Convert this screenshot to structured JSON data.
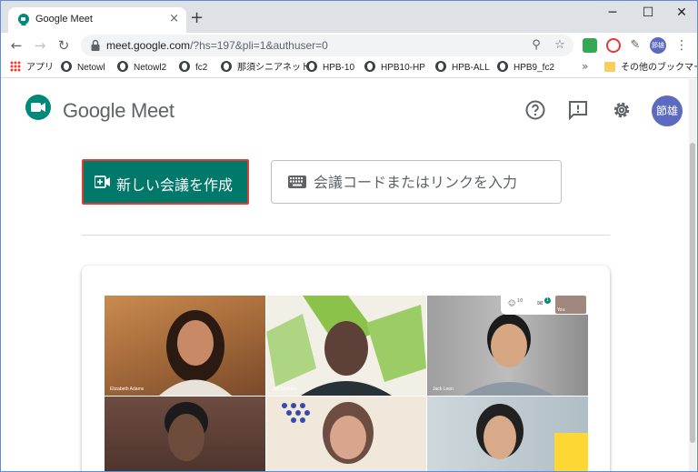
{
  "tab": {
    "title": "Google Meet",
    "close": "×",
    "new_tab": "+"
  },
  "window": {
    "minimize": "─",
    "maximize": "☐",
    "close": "✕"
  },
  "toolbar": {
    "url_host": "meet.google.com",
    "url_path": "/?hs=197&pli=1&authuser=0",
    "profile_label": "節雄"
  },
  "bookmarks": [
    {
      "label": "アプリ",
      "icon": "apps-icon"
    },
    {
      "label": "Netowl",
      "icon": "globe-icon"
    },
    {
      "label": "Netowl2",
      "icon": "globe-icon"
    },
    {
      "label": "fc2",
      "icon": "globe-icon"
    },
    {
      "label": "那須シニアネット",
      "icon": "globe-icon"
    },
    {
      "label": "HPB-10",
      "icon": "globe-icon"
    },
    {
      "label": "HPB10-HP",
      "icon": "globe-icon"
    },
    {
      "label": "HPB-ALL",
      "icon": "globe-icon"
    },
    {
      "label": "HPB9_fc2",
      "icon": "globe-icon"
    }
  ],
  "bookmarks_more": "»",
  "other_bookmarks": "その他のブックマーク",
  "meet": {
    "brand_google": "Google",
    "brand_meet": "Meet",
    "user_initials": "節雄",
    "new_meeting_label": "新しい会議を作成",
    "join_placeholder": "会議コードまたはリンクを入力",
    "participants": [
      {
        "name": "Elizabeth Adams"
      },
      {
        "name": "Jeff Sheldon"
      },
      {
        "name": "Jack Leon"
      },
      {
        "name": ""
      },
      {
        "name": ""
      },
      {
        "name": ""
      }
    ],
    "mini_count": "10",
    "mini_chat": "1",
    "mini_you": "You"
  },
  "colors": {
    "accent": "#00796b",
    "highlight": "#e53935",
    "brand_blue": "#1a73e8"
  }
}
